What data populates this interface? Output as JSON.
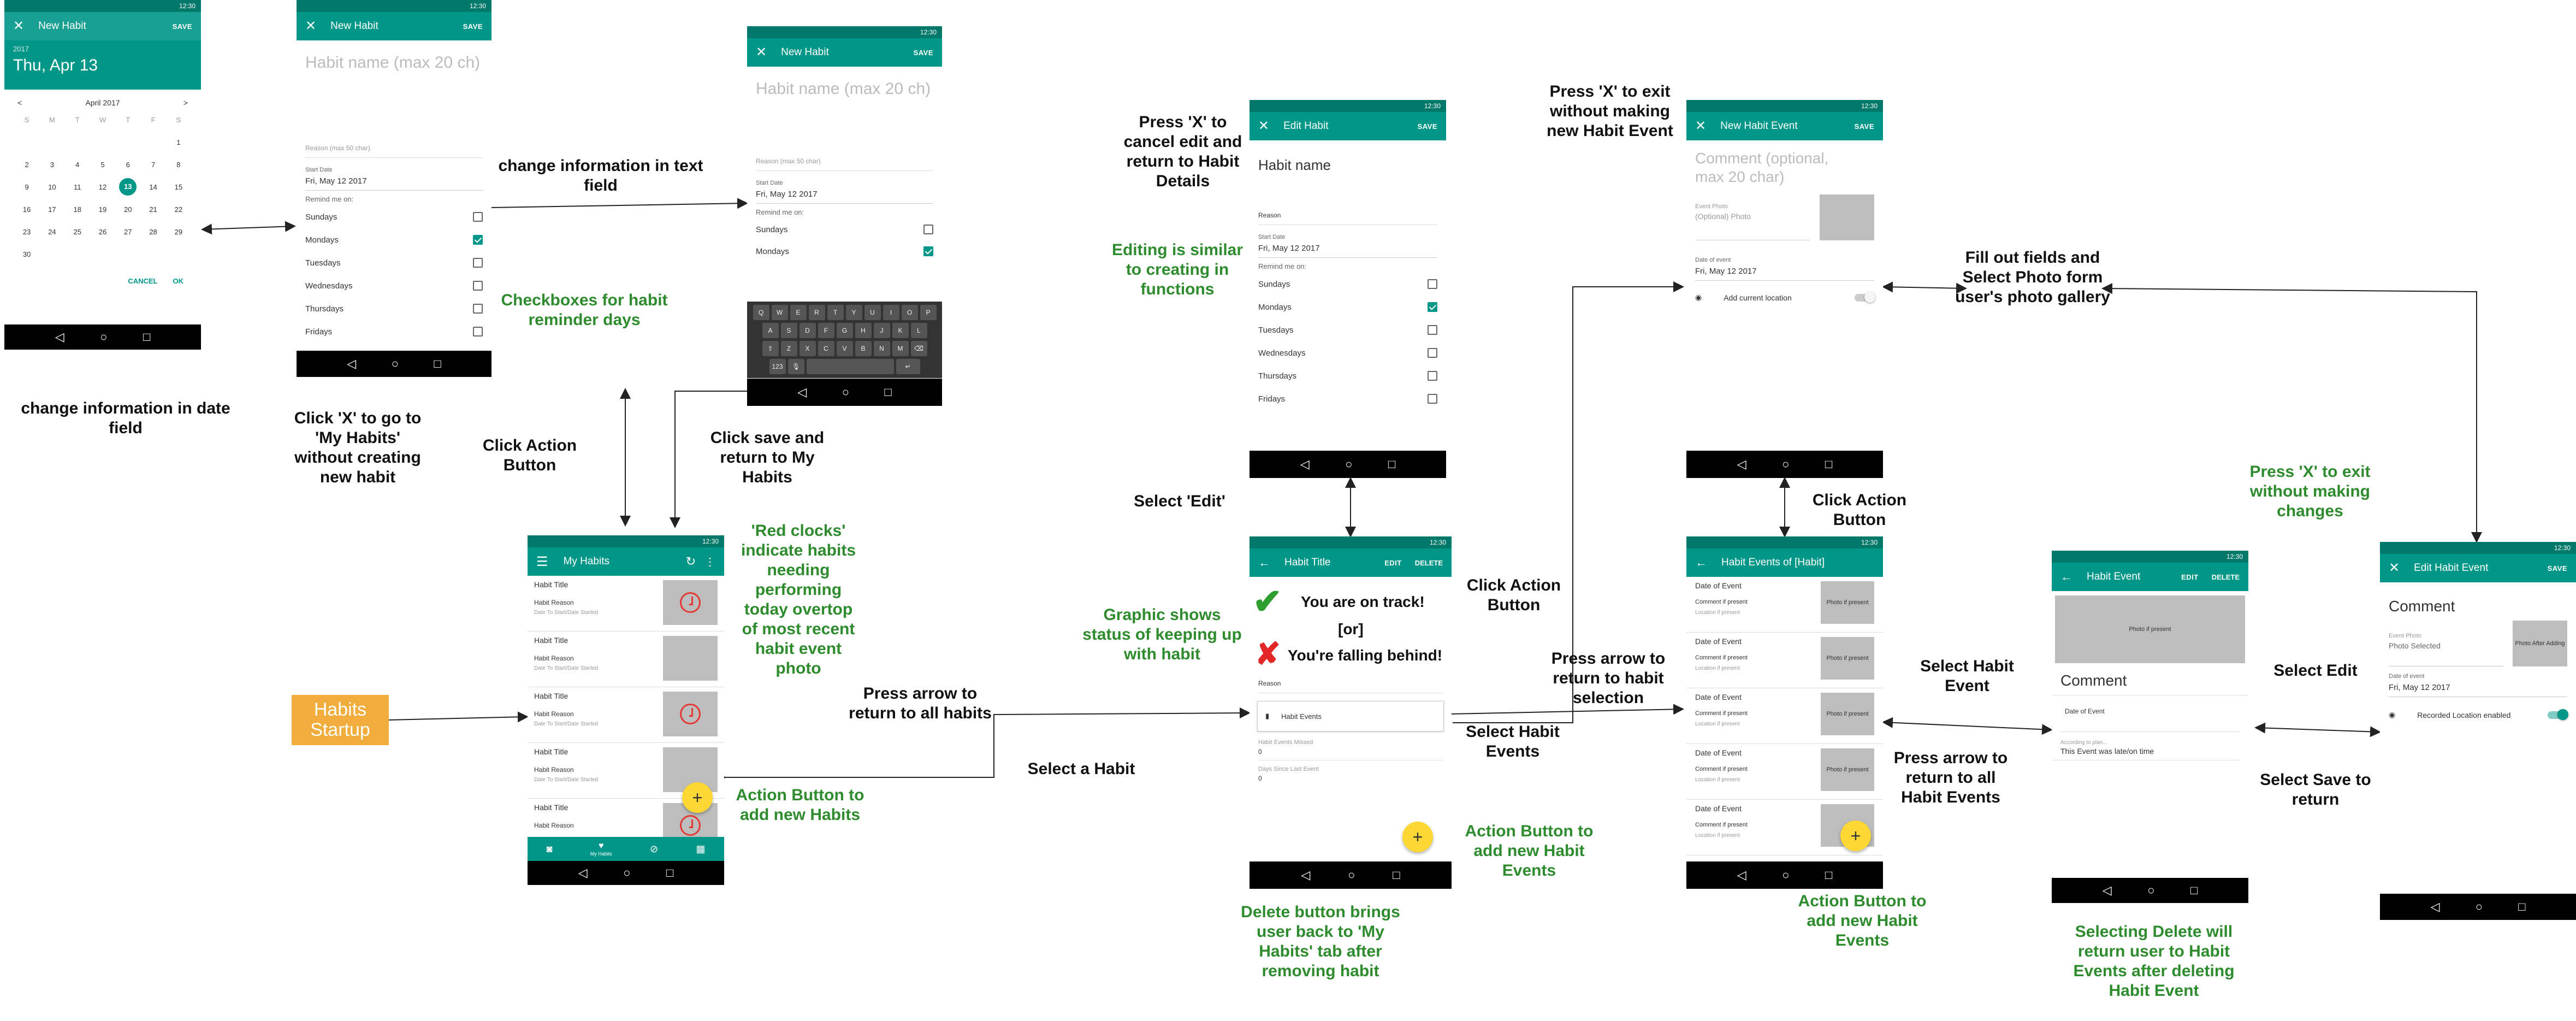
{
  "status_time": "12:30",
  "phone1": {
    "title": "New Habit",
    "save": "SAVE",
    "year": "2017",
    "date": "Thu, Apr 13",
    "month": "April 2017",
    "prev": "<",
    "next": ">",
    "weekdays": [
      "S",
      "M",
      "T",
      "W",
      "T",
      "F",
      "S"
    ],
    "days": [
      "",
      "",
      "",
      "",
      "",
      "",
      "1",
      "2",
      "3",
      "4",
      "5",
      "6",
      "7",
      "8",
      "9",
      "10",
      "11",
      "12",
      "13",
      "14",
      "15",
      "16",
      "17",
      "18",
      "19",
      "20",
      "21",
      "22",
      "23",
      "24",
      "25",
      "26",
      "27",
      "28",
      "29",
      "30"
    ],
    "selected_day": "13",
    "cancel": "CANCEL",
    "ok": "OK"
  },
  "phone2": {
    "title": "New Habit",
    "save": "SAVE",
    "name_placeholder": "Habit name (max 20 ch)",
    "reason_placeholder": "Reason (max 50 char)",
    "start_label": "Start Date",
    "start_value": "Fri, May 12 2017",
    "remind_label": "Remind me on:",
    "days": [
      {
        "label": "Sundays",
        "checked": false
      },
      {
        "label": "Mondays",
        "checked": true
      },
      {
        "label": "Tuesdays",
        "checked": false
      },
      {
        "label": "Wednesdays",
        "checked": false
      },
      {
        "label": "Thursdays",
        "checked": false
      },
      {
        "label": "Fridays",
        "checked": false
      }
    ]
  },
  "phone3": {
    "title": "New Habit",
    "save": "SAVE",
    "name_placeholder": "Habit name (max 20 ch)",
    "reason_placeholder": "Reason (max 50 char)",
    "start_label": "Start Date",
    "start_value": "Fri, May 12 2017",
    "remind_label": "Remind me on:",
    "keyboard_rows": [
      [
        "Q",
        "W",
        "E",
        "R",
        "T",
        "Y",
        "U",
        "I",
        "O",
        "P"
      ],
      [
        "A",
        "S",
        "D",
        "F",
        "G",
        "H",
        "J",
        "K",
        "L"
      ],
      [
        "Z",
        "X",
        "C",
        "V",
        "B",
        "N",
        "M"
      ]
    ],
    "key_123": "123"
  },
  "phone4": {
    "title": "My Habits",
    "rows": [
      {
        "title": "Habit Title",
        "reason": "Habit Reason",
        "date": "Date To Start/Date Started",
        "clock": true
      },
      {
        "title": "Habit Title",
        "reason": "Habit Reason",
        "date": "Date To Start/Date Started",
        "clock": false
      },
      {
        "title": "Habit Title",
        "reason": "Habit Reason",
        "date": "Date To Start/Date Started",
        "clock": true
      },
      {
        "title": "Habit Title",
        "reason": "Habit Reason",
        "date": "Date To Start/Date Started",
        "clock": false
      },
      {
        "title": "Habit Title",
        "reason": "Habit Reason",
        "date": "",
        "clock": true
      }
    ],
    "tab_active": "My Habits"
  },
  "phone5": {
    "title": "Edit Habit",
    "save": "SAVE",
    "name": "Habit name",
    "reason": "Reason",
    "start_label": "Start Date",
    "start_value": "Fri, May 12 2017",
    "remind_label": "Remind me on:",
    "days": [
      {
        "label": "Sundays",
        "checked": false
      },
      {
        "label": "Mondays",
        "checked": true
      },
      {
        "label": "Tuesdays",
        "checked": false
      },
      {
        "label": "Wednesdays",
        "checked": false
      },
      {
        "label": "Thursdays",
        "checked": false
      },
      {
        "label": "Fridays",
        "checked": false
      }
    ]
  },
  "phone6": {
    "title": "Habit Title",
    "edit": "EDIT",
    "delete": "DELETE",
    "on_track": "You are on track!",
    "or": "[or]",
    "behind": "You're falling behind!",
    "reason": "Reason",
    "events_btn": "Habit Events",
    "missed_label": "Habit Events Missed",
    "missed_value": "0",
    "since_label": "Days Since Last Event",
    "since_value": "0"
  },
  "phone7": {
    "title": "New Habit Event",
    "save": "SAVE",
    "comment_placeholder": "Comment (optional, max 20 char)",
    "photo_label": "Event Photo",
    "photo_value": "(Optional) Photo",
    "date_label": "Date of event",
    "date_value": "Fri, May 12 2017",
    "location": "Add current location"
  },
  "phone8": {
    "title": "Habit Events of [Habit]",
    "rows": [
      {
        "date": "Date of Event",
        "comment": "Comment if present",
        "loc": "Location if present",
        "photo": "Photo if present"
      },
      {
        "date": "Date of Event",
        "comment": "Comment if present",
        "loc": "Location if present",
        "photo": "Photo if present"
      },
      {
        "date": "Date of Event",
        "comment": "Comment if present",
        "loc": "Location if present",
        "photo": "Photo if present"
      },
      {
        "date": "Date of Event",
        "comment": "Comment if present",
        "loc": "Location if present",
        "photo": "Photo if present"
      },
      {
        "date": "Date of Event",
        "comment": "Comment if present",
        "loc": "Location if present",
        "photo": ""
      }
    ]
  },
  "phone9": {
    "title": "Habit Event",
    "edit": "EDIT",
    "delete": "DELETE",
    "photo": "Photo if present",
    "comment": "Comment",
    "date": "Date of Event",
    "plan_label": "According to plan...",
    "plan_value": "This Event was late/on time"
  },
  "phone10": {
    "title": "Edit Habit Event",
    "save": "SAVE",
    "comment": "Comment",
    "photo_label": "Event Photo",
    "photo_value": "Photo Selected",
    "photo_box": "Photo After Adding",
    "date_label": "Date of event",
    "date_value": "Fri, May 12 2017",
    "location": "Recorded Location enabled"
  },
  "annotations": {
    "a_change_date": "change information in date field",
    "a_change_text": "change information in text field",
    "a_checkboxes": "Checkboxes for habit reminder days",
    "a_click_x": "Click 'X' to go to 'My Habits' without creating new habit",
    "a_click_action": "Click Action Button",
    "a_click_save": "Click save and return to My Habits",
    "a_red_clocks": "'Red clocks' indicate habits needing performing today overtop of most recent habit event photo",
    "a_action_new_habits": "Action Button to add new Habits",
    "a_startup": "Habits Startup",
    "a_press_arrow_all": "Press arrow to return to all habits",
    "a_select_habit": "Select a Habit",
    "a_press_x_cancel": "Press 'X' to cancel edit and return to Habit Details",
    "a_editing_similar": "Editing is similar to creating in functions",
    "a_select_edit": "Select 'Edit'",
    "a_graphic": "Graphic shows status of keeping up with habit",
    "a_delete_btn": "Delete button brings user back to 'My Habits' tab after removing habit",
    "a_click_action2": "Click Action Button",
    "a_select_events": "Select Habit Events",
    "a_action_events": "Action Button to add new Habit Events",
    "a_press_x_exit": "Press 'X' to exit without making new Habit Event",
    "a_fill_out": "Fill out fields and Select Photo form user's photo gallery",
    "a_click_action3": "Click Action Button",
    "a_press_arrow_sel": "Press arrow to return to habit selection",
    "a_action_events2": "Action Button to add new Habit Events",
    "a_select_event": "Select Habit Event",
    "a_press_arrow_events": "Press arrow to return to all Habit Events",
    "a_selecting_delete": "Selecting Delete will return user to Habit Events after deleting Habit Event",
    "a_select_edit2": "Select Edit",
    "a_press_x_changes": "Press 'X' to exit without making changes",
    "a_select_save": "Select Save to return"
  }
}
